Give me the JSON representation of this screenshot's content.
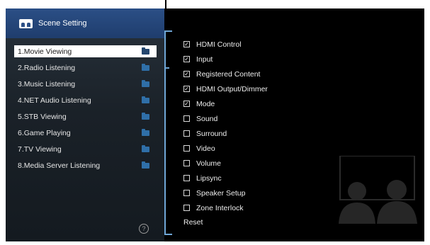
{
  "left_panel": {
    "title": "Scene Setting",
    "items": [
      {
        "label": "1.Movie Viewing",
        "selected": true
      },
      {
        "label": "2.Radio Listening",
        "selected": false
      },
      {
        "label": "3.Music Listening",
        "selected": false
      },
      {
        "label": "4.NET Audio Listening",
        "selected": false
      },
      {
        "label": "5.STB Viewing",
        "selected": false
      },
      {
        "label": "6.Game Playing",
        "selected": false
      },
      {
        "label": "7.TV Viewing",
        "selected": false
      },
      {
        "label": "8.Media Server Listening",
        "selected": false
      }
    ],
    "help_glyph": "?"
  },
  "right_panel": {
    "options": [
      {
        "label": "HDMI Control",
        "checked": true
      },
      {
        "label": "Input",
        "checked": true
      },
      {
        "label": "Registered Content",
        "checked": true
      },
      {
        "label": "HDMI Output/Dimmer",
        "checked": true
      },
      {
        "label": "Mode",
        "checked": true
      },
      {
        "label": "Sound",
        "checked": false
      },
      {
        "label": "Surround",
        "checked": false
      },
      {
        "label": "Video",
        "checked": false
      },
      {
        "label": "Volume",
        "checked": false
      },
      {
        "label": "Lipsync",
        "checked": false
      },
      {
        "label": "Speaker Setup",
        "checked": false
      },
      {
        "label": "Zone Interlock",
        "checked": false
      }
    ],
    "reset_label": "Reset"
  },
  "colors": {
    "header_blue": "#2b4f86",
    "folder_blue": "#2f6fa8",
    "bracket_blue": "#6fa6d6"
  }
}
